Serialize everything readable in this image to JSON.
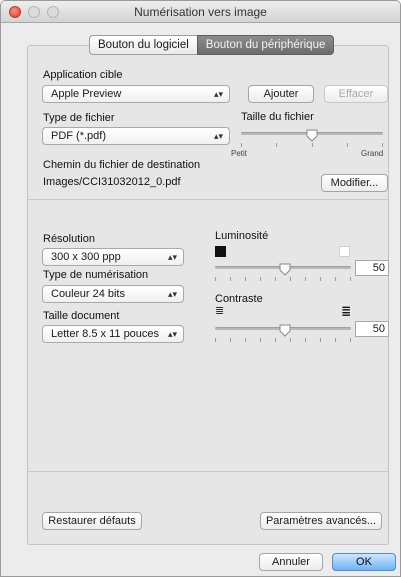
{
  "window": {
    "title": "Numérisation vers image"
  },
  "tabs": [
    {
      "label": "Bouton du logiciel",
      "active": false
    },
    {
      "label": "Bouton du périphérique",
      "active": true
    }
  ],
  "target_app": {
    "label": "Application cible",
    "value": "Apple Preview",
    "add_button": "Ajouter",
    "delete_button": "Effacer"
  },
  "file_type": {
    "label": "Type de fichier",
    "value": "PDF (*.pdf)"
  },
  "file_size": {
    "label": "Taille du fichier",
    "min_label": "Petit",
    "max_label": "Grand",
    "level": 0.5
  },
  "destination": {
    "label": "Chemin du fichier de destination",
    "path": "Images/CCI31032012_0.pdf",
    "modify_button": "Modifier..."
  },
  "resolution": {
    "label": "Résolution",
    "value": "300 x 300 ppp"
  },
  "scan_type": {
    "label": "Type de numérisation",
    "value": "Couleur 24 bits"
  },
  "document_size": {
    "label": "Taille document",
    "value": "Letter 8.5 x 11 pouces"
  },
  "brightness": {
    "label": "Luminosité",
    "value": "50",
    "level": 0.5
  },
  "contrast": {
    "label": "Contraste",
    "value": "50",
    "level": 0.5
  },
  "footer": {
    "restore_button": "Restaurer défauts",
    "advanced_button": "Paramètres avancés...",
    "cancel_button": "Annuler",
    "ok_button": "OK"
  },
  "colors": {
    "accent": "#6fb3f5",
    "active_tab": "#7a7a7a"
  }
}
